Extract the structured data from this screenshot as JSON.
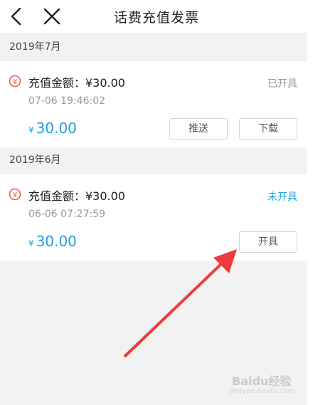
{
  "header": {
    "title": "话费充值发票"
  },
  "sections": [
    {
      "month": "2019年7月",
      "item": {
        "amount_label": "充值金额：¥30.00",
        "datetime": "07-06 19:46:02",
        "status": "已开具",
        "price_symbol": "¥",
        "price_value": "30.00",
        "buttons": [
          "推送",
          "下载"
        ]
      }
    },
    {
      "month": "2019年6月",
      "item": {
        "amount_label": "充值金额：¥30.00",
        "datetime": "06-06 07:27:59",
        "status": "未开具",
        "price_symbol": "¥",
        "price_value": "30.00",
        "buttons": [
          "开具"
        ]
      }
    }
  ],
  "watermark": {
    "brand": "Baidu经验",
    "sub": "jingyan.baidu.com"
  },
  "colors": {
    "accent": "#1ea0e0",
    "annotation_arrow": "#f03a3a"
  }
}
